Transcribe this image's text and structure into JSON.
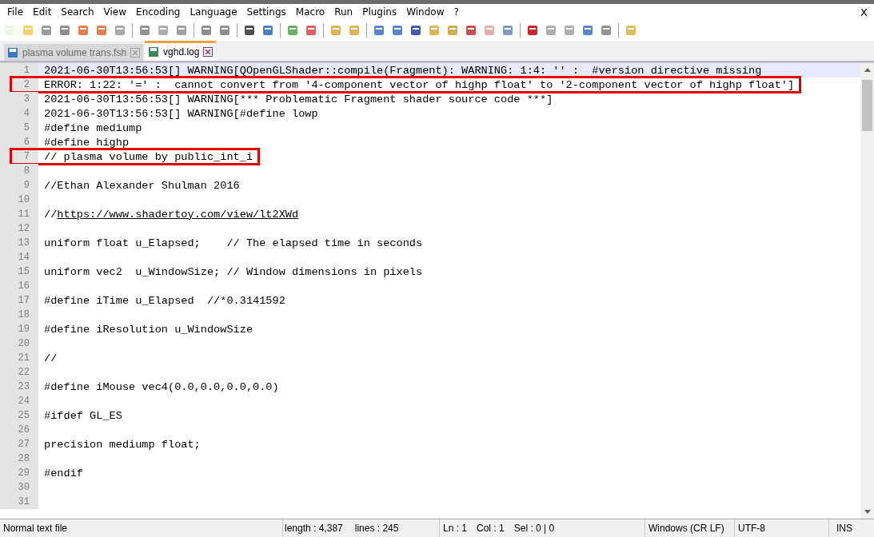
{
  "menu": [
    "File",
    "Edit",
    "Search",
    "View",
    "Encoding",
    "Language",
    "Settings",
    "Macro",
    "Run",
    "Plugins",
    "Window",
    "?"
  ],
  "close_label": "X",
  "tabs": [
    {
      "label": "plasma volume trans.fsh",
      "selected": false
    },
    {
      "label": "vghd.log",
      "selected": true
    }
  ],
  "lines": [
    {
      "number": "1",
      "text": "2021-06-30T13:56:53[] WARNING[QOpenGLShader::compile(Fragment): WARNING: 1:4: '' :  #version directive missing",
      "current": true,
      "boxed": false
    },
    {
      "number": "2",
      "text": "ERROR: 1:22: '=' :  cannot convert from '4-component vector of highp float' to '2-component vector of highp float']",
      "current": false,
      "boxed": true
    },
    {
      "number": "3",
      "text": "2021-06-30T13:56:53[] WARNING[*** Problematic Fragment shader source code ***]",
      "current": false,
      "boxed": false
    },
    {
      "number": "4",
      "text": "2021-06-30T13:56:53[] WARNING[#define lowp",
      "current": false,
      "boxed": false
    },
    {
      "number": "5",
      "text": "#define mediump",
      "current": false,
      "boxed": false
    },
    {
      "number": "6",
      "text": "#define highp",
      "current": false,
      "boxed": false
    },
    {
      "number": "7",
      "text": "// plasma volume by public_int_i",
      "current": false,
      "boxed": true
    },
    {
      "number": "8",
      "current": false,
      "boxed": false
    },
    {
      "number": "9",
      "text": "//Ethan Alexander Shulman 2016",
      "current": false,
      "boxed": false
    },
    {
      "number": "10",
      "current": false,
      "boxed": false
    },
    {
      "number": "11",
      "text": "//",
      "link": "https://www.shadertoy.com/view/lt2XWd",
      "current": false,
      "boxed": false
    },
    {
      "number": "12",
      "current": false,
      "boxed": false
    },
    {
      "number": "13",
      "text": "uniform float u_Elapsed;    // The elapsed time in seconds",
      "current": false,
      "boxed": false
    },
    {
      "number": "14",
      "current": false,
      "boxed": false
    },
    {
      "number": "15",
      "text": "uniform vec2  u_WindowSize; // Window dimensions in pixels",
      "current": false,
      "boxed": false
    },
    {
      "number": "16",
      "current": false,
      "boxed": false
    },
    {
      "number": "17",
      "text": "#define iTime u_Elapsed  //*0.3141592",
      "current": false,
      "boxed": false
    },
    {
      "number": "18",
      "current": false,
      "boxed": false
    },
    {
      "number": "19",
      "text": "#define iResolution u_WindowSize",
      "current": false,
      "boxed": false
    },
    {
      "number": "20",
      "current": false,
      "boxed": false
    },
    {
      "number": "21",
      "text": "//",
      "current": false,
      "boxed": false
    },
    {
      "number": "22",
      "current": false,
      "boxed": false
    },
    {
      "number": "23",
      "text": "#define iMouse vec4(0.0,0.0,0.0,0.0)",
      "current": false,
      "boxed": false
    },
    {
      "number": "24",
      "current": false,
      "boxed": false
    },
    {
      "number": "25",
      "text": "#ifdef GL_ES",
      "current": false,
      "boxed": false
    },
    {
      "number": "26",
      "current": false,
      "boxed": false
    },
    {
      "number": "27",
      "text": "precision mediump float;",
      "current": false,
      "boxed": false
    },
    {
      "number": "28",
      "current": false,
      "boxed": false
    },
    {
      "number": "29",
      "text": "#endif",
      "current": false,
      "boxed": false
    },
    {
      "number": "30",
      "current": false,
      "boxed": false
    },
    {
      "number": "31",
      "current": false,
      "boxed": false
    }
  ],
  "status_bar": {
    "file_type": "Normal text file",
    "length": "length : 4,387",
    "lines": "lines : 245",
    "ln": "Ln : 1",
    "col": "Col : 1",
    "sel": "Sel : 0 | 0",
    "eol": "Windows (CR LF)",
    "encoding": "UTF-8",
    "mode": "INS"
  }
}
